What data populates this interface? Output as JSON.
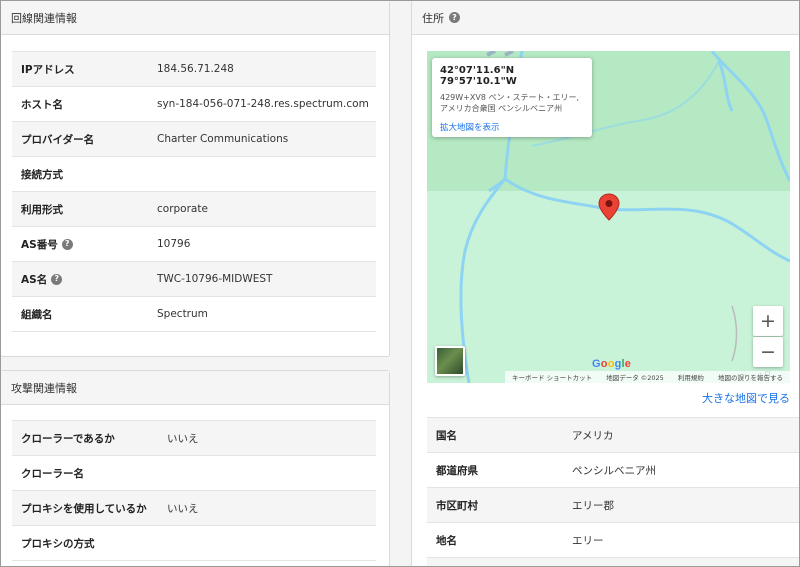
{
  "line_info": {
    "title": "回線関連情報",
    "rows": [
      {
        "label": "IPアドレス",
        "value": "184.56.71.248",
        "help": false
      },
      {
        "label": "ホスト名",
        "value": "syn-184-056-071-248.res.spectrum.com",
        "help": false
      },
      {
        "label": "プロバイダー名",
        "value": "Charter Communications",
        "help": false
      },
      {
        "label": "接続方式",
        "value": "",
        "help": false
      },
      {
        "label": "利用形式",
        "value": "corporate",
        "help": false
      },
      {
        "label": "AS番号",
        "value": "10796",
        "help": true
      },
      {
        "label": "AS名",
        "value": "TWC-10796-MIDWEST",
        "help": true
      },
      {
        "label": "組織名",
        "value": "Spectrum",
        "help": false
      }
    ]
  },
  "attack_info": {
    "title": "攻撃関連情報",
    "rows": [
      {
        "label": "クローラーであるか",
        "value": "いいえ"
      },
      {
        "label": "クローラー名",
        "value": ""
      },
      {
        "label": "プロキシを使用しているか",
        "value": "いいえ"
      },
      {
        "label": "プロキシの方式",
        "value": ""
      }
    ]
  },
  "address": {
    "title": "住所",
    "help_icon": "question-circle-icon",
    "map": {
      "coords": "42°07'11.6\"N 79°57'10.1\"W",
      "addr_line1": "429W+XV8 ペン・ステート・エリー,",
      "addr_line2": "アメリカ合衆国 ペンシルベニア州",
      "enlarge_link": "拡大地図を表示",
      "zoom_in": "+",
      "zoom_out": "−",
      "google_logo": "Google",
      "footer_shortcuts": "キーボード ショートカット",
      "footer_data": "地図データ ©2025",
      "footer_terms": "利用規約",
      "footer_report": "地図の誤りを報告する",
      "edge_label": "・ロ",
      "pin_color": "#ea4335",
      "water_color": "#8ed4f2",
      "land_color": "#c9f3d9"
    },
    "bigger_map_link": "大きな地図で見る",
    "rows": [
      {
        "label": "国名",
        "value": "アメリカ"
      },
      {
        "label": "都道府県",
        "value": "ペンシルベニア州"
      },
      {
        "label": "市区町村",
        "value": "エリー郡"
      },
      {
        "label": "地名",
        "value": "エリー"
      },
      {
        "label": "",
        "value": ""
      }
    ]
  }
}
